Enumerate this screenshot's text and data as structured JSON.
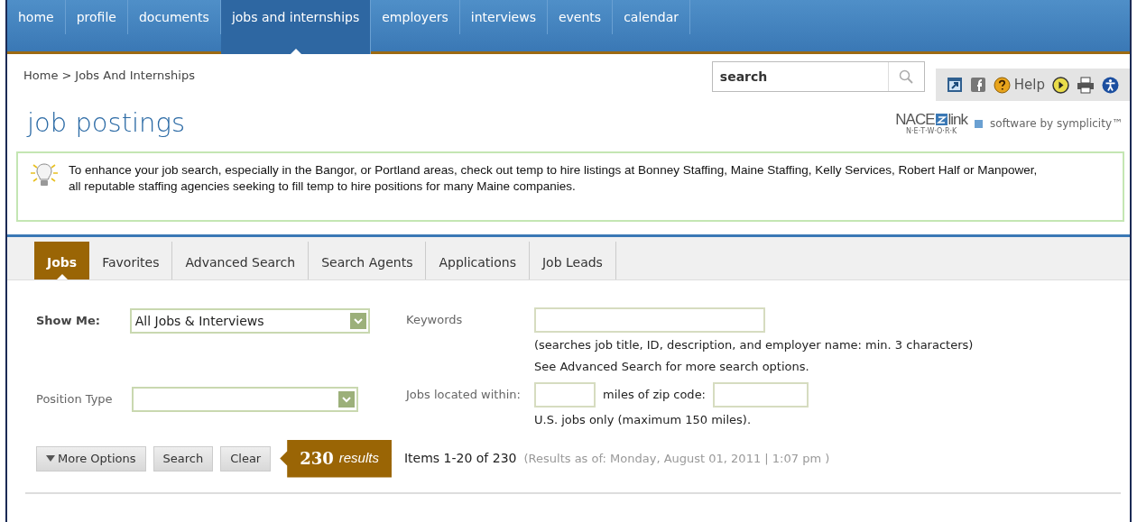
{
  "nav": [
    {
      "label": "home",
      "selected": false
    },
    {
      "label": "profile",
      "selected": false
    },
    {
      "label": "documents",
      "selected": false
    },
    {
      "label": "jobs and internships",
      "selected": true
    },
    {
      "label": "employers",
      "selected": false
    },
    {
      "label": "interviews",
      "selected": false
    },
    {
      "label": "events",
      "selected": false
    },
    {
      "label": "calendar",
      "selected": false
    }
  ],
  "breadcrumb": [
    "Home",
    "Jobs And Internships"
  ],
  "breadcrumb_separator": ">",
  "search": {
    "value": "search"
  },
  "help_label": "Help",
  "title": "job postings",
  "logo": {
    "left": "NACE",
    "right": "link",
    "network": "N·E·T·W·O·R·K",
    "vendor": "software by symplicity™"
  },
  "notice": "To enhance your job search, especially in the Bangor, or Portland areas, check out temp to hire listings at Bonney Staffing, Maine Staffing, Kelly Services, Robert Half or Manpower, all reputable staffing agencies seeking to fill temp to hire positions for many Maine companies.",
  "tabs": [
    {
      "label": "Jobs",
      "selected": true
    },
    {
      "label": "Favorites",
      "selected": false
    },
    {
      "label": "Advanced Search",
      "selected": false
    },
    {
      "label": "Search Agents",
      "selected": false
    },
    {
      "label": "Applications",
      "selected": false
    },
    {
      "label": "Job Leads",
      "selected": false
    }
  ],
  "form": {
    "show_me_label": "Show Me:",
    "show_me_value": "All Jobs & Interviews",
    "keywords_label": "Keywords",
    "keywords_hint": "(searches job title, ID, description, and employer name: min. 3 characters)",
    "keywords_hint2": "See Advanced Search for more search options.",
    "position_type_label": "Position Type",
    "within_label": "Jobs located within:",
    "zip_label": "miles of zip code:",
    "distance_hint": "U.S. jobs only (maximum 150 miles)."
  },
  "buttons": [
    "More Options",
    "Search",
    "Clear"
  ],
  "results_badge": "**230** *results*",
  "items_text": "Items 1-20 of 230",
  "results_as_of": "(Results as of: Monday, August 01, 2011 | 1:07 pm )"
}
